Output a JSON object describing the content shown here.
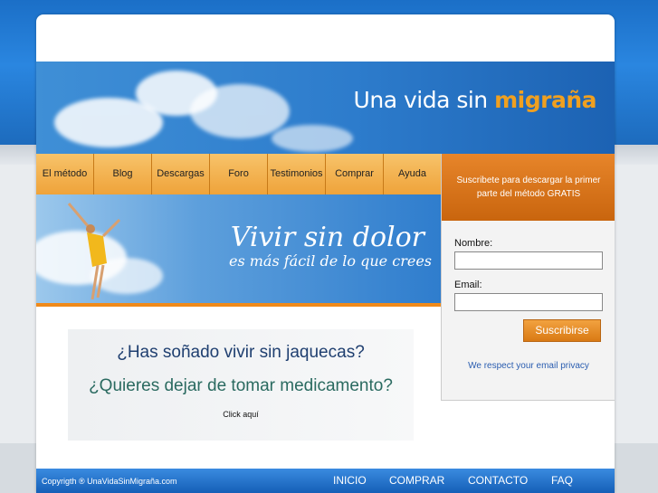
{
  "header": {
    "title_main": "Una vida sin ",
    "title_accent": "migraña"
  },
  "nav": {
    "items": [
      "El método",
      "Blog",
      "Descargas",
      "Foro",
      "Testimonios",
      "Comprar",
      "Ayuda"
    ]
  },
  "banner": {
    "title": "Vivir sin dolor",
    "subtitle": "es más fácil de lo que crees"
  },
  "subscribe": {
    "heading": "Suscribete para descargar la primer parte del método GRATIS",
    "name_label": "Nombre:",
    "email_label": "Email:",
    "name_value": "",
    "email_value": "",
    "button": "Suscribirse",
    "privacy": "We respect your email privacy"
  },
  "promo": {
    "question1": "¿Has soñado vivir sin jaquecas?",
    "question2": "¿Quieres dejar de tomar medicamento?",
    "click": "Click aquí"
  },
  "footer": {
    "copyright": "Copyrigth ® UnaVidaSinMigraña.com",
    "links": [
      "INICIO",
      "COMPRAR",
      "CONTACTO",
      "FAQ"
    ]
  },
  "colors": {
    "accent_orange": "#f0a020",
    "header_blue": "#2d7ccc"
  }
}
